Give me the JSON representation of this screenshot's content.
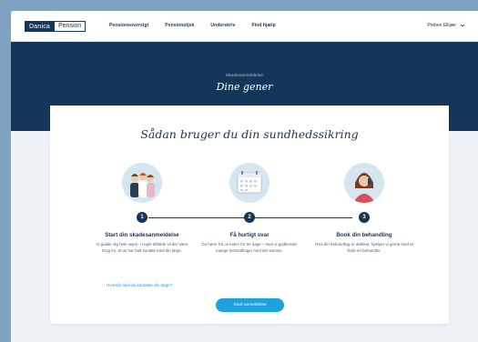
{
  "logo": {
    "part_a": "Danica",
    "part_b": "Pension"
  },
  "nav": {
    "items": [
      {
        "label": "Pensionsoversigt"
      },
      {
        "label": "Pensionstjek"
      },
      {
        "label": "Underskriv"
      },
      {
        "label": "Find hjælp"
      }
    ],
    "user": "Preben Elkjær"
  },
  "hero": {
    "subtitle": "Skadesanmeldelse",
    "title": "Dine gener"
  },
  "card": {
    "title": "Sådan bruger du din sundhedssikring",
    "steps": [
      {
        "number": "1",
        "title": "Start din skadesanmeldelse",
        "text": "Vi guider dig hele vejen. I nogle tilfælde vil der være brug for, at du har haft kontakt med din læge."
      },
      {
        "number": "2",
        "title": "Få hurtigt svar",
        "text": "Du hører fra os inden for tre dage – men vi godkender mange behandlinger med det samme."
      },
      {
        "number": "3",
        "title": "Book din behandling",
        "text": "Hvis din behandling er dækket, hjælper vi gerne med at finde en behandler."
      }
    ],
    "link": "Hvornår skal du kontakte din læge?",
    "button": "Start anmeldelse"
  },
  "colors": {
    "navy": "#13365a",
    "accent": "#1da1df",
    "illustration_bg": "#d6e6f0"
  },
  "icons": [
    "chevron-down-icon"
  ]
}
